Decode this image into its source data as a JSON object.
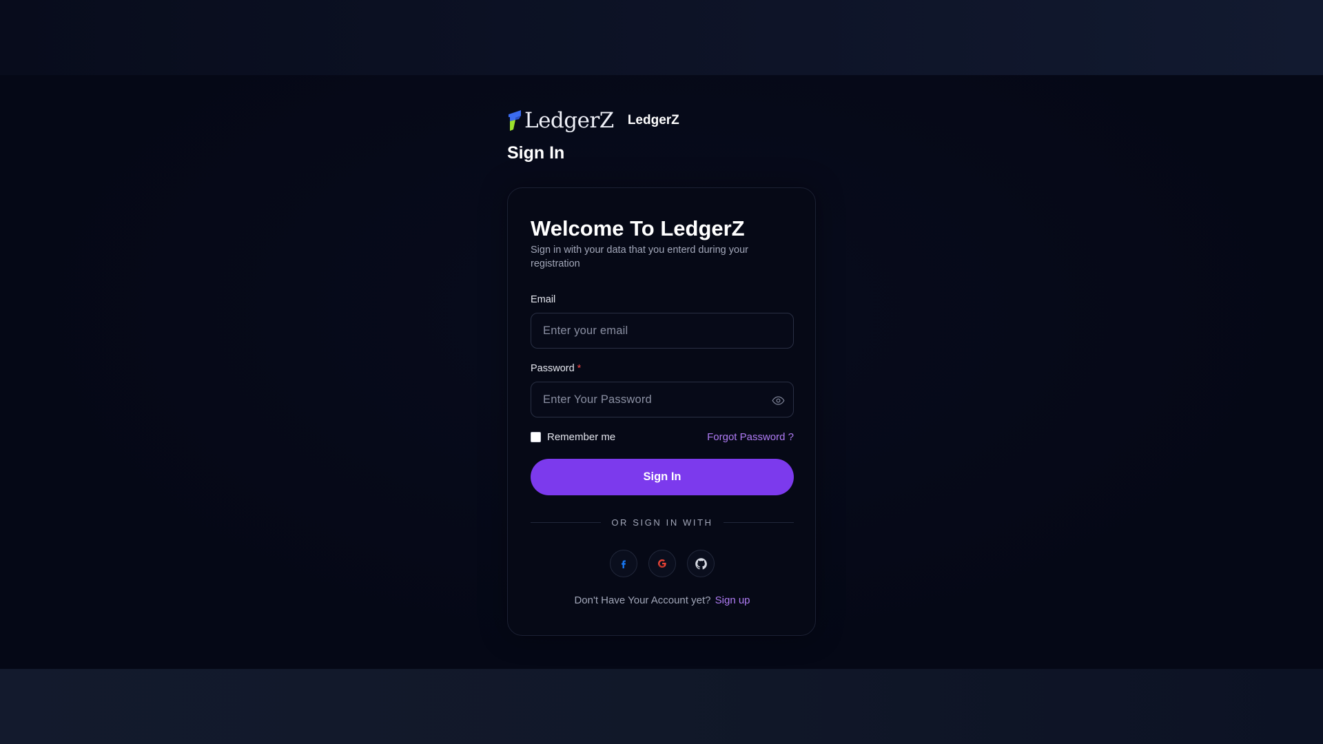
{
  "brand": {
    "logo_text": "LedgerZ",
    "name": "LedgerZ"
  },
  "page": {
    "title": "Sign In"
  },
  "card": {
    "welcome_title": "Welcome To LedgerZ",
    "subtitle": "Sign in with your data that you enterd during your registration"
  },
  "form": {
    "email_label": "Email",
    "email_placeholder": "Enter your email",
    "email_value": "",
    "password_label": "Password",
    "password_required_mark": "*",
    "password_placeholder": "Enter Your Password",
    "password_value": "",
    "remember_label": "Remember me",
    "remember_checked": false,
    "forgot_label": "Forgot Password ?",
    "submit_label": "Sign In"
  },
  "social": {
    "divider_text": "OR SIGN IN WITH",
    "providers": [
      {
        "name": "facebook",
        "icon": "facebook-icon",
        "color": "#1877f2"
      },
      {
        "name": "google",
        "icon": "google-icon",
        "color": "#ea4335"
      },
      {
        "name": "github",
        "icon": "github-icon",
        "color": "#d7dae3"
      }
    ]
  },
  "footer": {
    "no_account_text": "Don't Have Your Account yet?",
    "signup_label": "Sign up"
  },
  "colors": {
    "accent": "#7c3aed",
    "link": "#b07cf5",
    "required": "#ef4444",
    "background": "#070a18"
  }
}
